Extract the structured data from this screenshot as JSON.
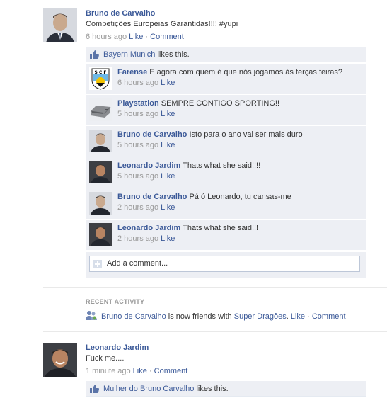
{
  "post1": {
    "author": "Bruno de Carvalho",
    "message": "Competições Europeias Garantidas!!!! #yupi",
    "time": "6 hours ago",
    "like_label": "Like",
    "separator": "·",
    "comment_label": "Comment",
    "likes": {
      "name": "Bayern Munich",
      "suffix": "likes this."
    },
    "comments": [
      {
        "author": "Farense",
        "text": "E agora com quem é que nós jogamos às terças feiras?",
        "time": "6 hours ago",
        "like_label": "Like",
        "avatar_icon": "farense-crest-icon"
      },
      {
        "author": "Playstation",
        "text": "SEMPRE CONTIGO SPORTING!!",
        "time": "5 hours ago",
        "like_label": "Like",
        "avatar_icon": "playstation-console-icon"
      },
      {
        "author": "Bruno de Carvalho",
        "text": "Isto para o ano vai ser mais duro",
        "time": "5 hours ago",
        "like_label": "Like",
        "avatar_icon": "user-avatar-icon"
      },
      {
        "author": "Leonardo Jardim",
        "text": "Thats what she said!!!!",
        "time": "5 hours ago",
        "like_label": "Like",
        "avatar_icon": "user-avatar-icon"
      },
      {
        "author": "Bruno de Carvalho",
        "text": "Pá ó Leonardo, tu cansas-me",
        "time": "2 hours ago",
        "like_label": "Like",
        "avatar_icon": "user-avatar-icon"
      },
      {
        "author": "Leonardo Jardim",
        "text": "Thats what she said!!!",
        "time": "2 hours ago",
        "like_label": "Like",
        "avatar_icon": "user-avatar-icon"
      }
    ],
    "add_comment_placeholder": "Add a comment..."
  },
  "recent_activity": {
    "title": "RECENT ACTIVITY",
    "actor": "Bruno de Carvalho",
    "middle": "is now friends with",
    "target": "Super Dragões",
    "after_target": ".",
    "like_label": "Like",
    "separator": "·",
    "comment_label": "Comment"
  },
  "post2": {
    "author": "Leonardo Jardim",
    "message": "Fuck me....",
    "time": "1 minute ago",
    "like_label": "Like",
    "separator": "·",
    "comment_label": "Comment",
    "likes": {
      "name": "Mulher do Bruno Carvalho",
      "suffix": "likes this."
    }
  },
  "colors": {
    "link": "#3b5998",
    "comment_bg": "#edeff4",
    "meta": "#999999"
  }
}
